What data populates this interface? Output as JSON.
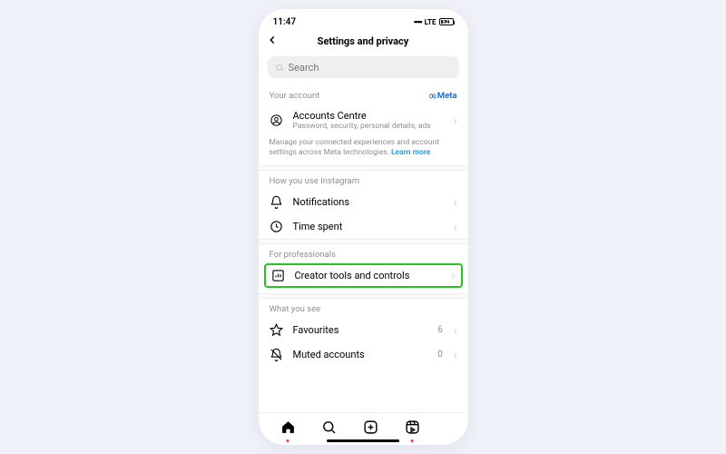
{
  "status": {
    "time": "11:47",
    "network": "LTE",
    "battery_pct": "62"
  },
  "header": {
    "title": "Settings and privacy"
  },
  "search": {
    "placeholder": "Search"
  },
  "your_account": {
    "label": "Your account",
    "brand": "Meta",
    "item": {
      "title": "Accounts Centre",
      "subtitle": "Password, security, personal details, ads"
    },
    "note": "Manage your connected experiences and account settings across Meta technologies.",
    "learn_more": "Learn more"
  },
  "how_you_use": {
    "label": "How you use Instagram",
    "items": [
      {
        "title": "Notifications"
      },
      {
        "title": "Time spent"
      }
    ]
  },
  "professionals": {
    "label": "For professionals",
    "item": {
      "title": "Creator tools and controls"
    }
  },
  "what_you_see": {
    "label": "What you see",
    "items": [
      {
        "title": "Favourites",
        "count": "6"
      },
      {
        "title": "Muted accounts",
        "count": "0"
      }
    ]
  }
}
